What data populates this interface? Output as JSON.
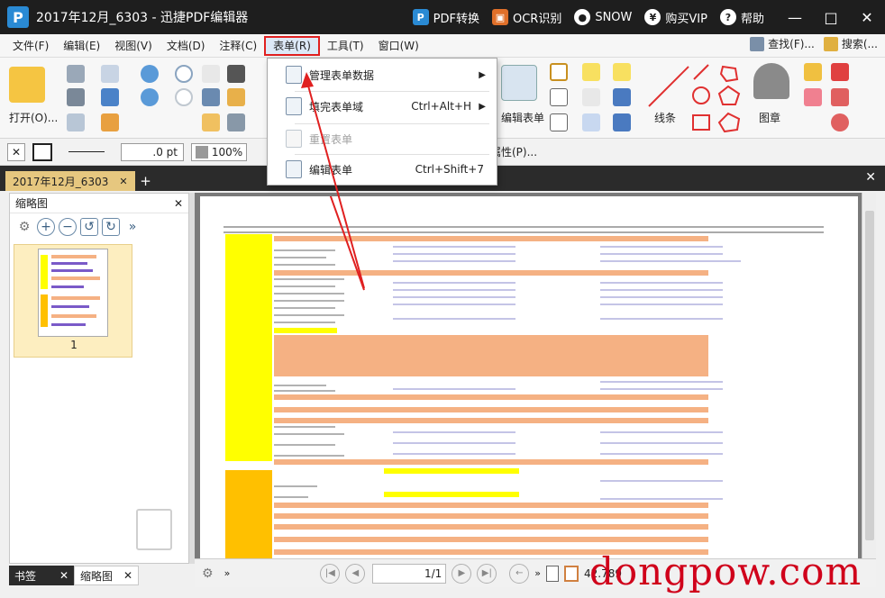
{
  "titlebar": {
    "title": "2017年12月_6303 - 迅捷PDF编辑器",
    "pdf_convert": "PDF转换",
    "ocr": "OCR识别",
    "user": "SNOW",
    "vip": "购买VIP",
    "help": "帮助",
    "minimize": "—",
    "maximize": "□",
    "close": "✕"
  },
  "menubar": {
    "items": [
      "文件(F)",
      "编辑(E)",
      "视图(V)",
      "文档(D)",
      "注释(C)",
      "表单(R)",
      "工具(T)",
      "窗口(W)"
    ],
    "find": "查找(F)...",
    "search": "搜索(..."
  },
  "ribbon": {
    "open": "打开(O)...",
    "edit_form": "编辑表单",
    "lines": "线条",
    "stamp": "图章"
  },
  "formatbar": {
    "line_width": ".0 pt",
    "opacity": "100%",
    "properties": "属性(P)..."
  },
  "tabs": {
    "doc_tab": "2017年12月_6303"
  },
  "leftpanel": {
    "title": "缩略图",
    "page_num": "1",
    "bottom_tabs": [
      "书签",
      "缩略图"
    ]
  },
  "statusbar": {
    "page": "1/1",
    "zoom": "42.789"
  },
  "dropdown": {
    "items": [
      {
        "label": "管理表单数据",
        "shortcut": "",
        "submenu": true,
        "disabled": false
      },
      {
        "label": "填完表单域",
        "shortcut": "Ctrl+Alt+H",
        "submenu": true,
        "disabled": false
      },
      {
        "label": "重置表单",
        "shortcut": "",
        "submenu": false,
        "disabled": true
      },
      {
        "label": "编辑表单",
        "shortcut": "Ctrl+Shift+7",
        "submenu": false,
        "disabled": false
      }
    ]
  },
  "watermark": "dongpow.com",
  "colors": {
    "titlebar": "#1e1e1e",
    "highlight_red": "#e02020",
    "doc_yellow": "#ffff00",
    "doc_orange": "#f5b183",
    "doc_gold": "#ffc000"
  }
}
